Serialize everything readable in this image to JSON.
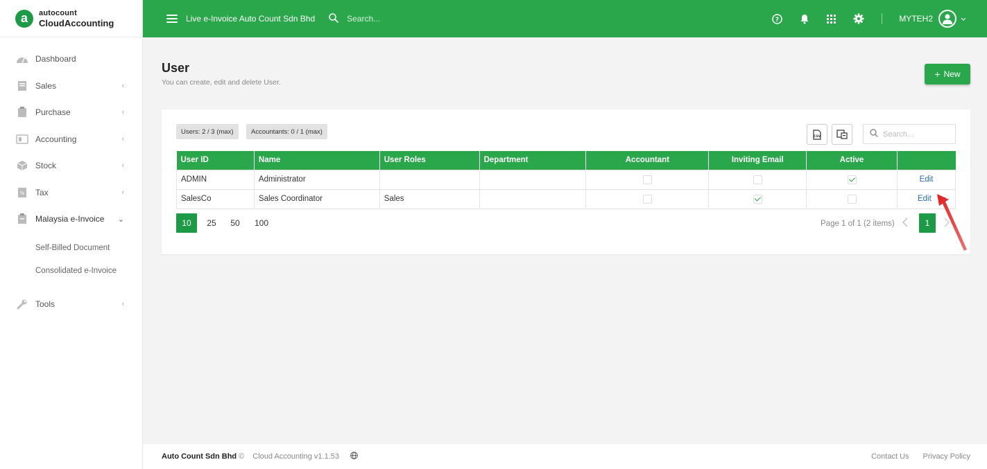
{
  "brand": {
    "top": "autocount",
    "bottom": "CloudAccounting",
    "mark": "a"
  },
  "sidebar": {
    "items": [
      {
        "label": "Dashboard",
        "icon": "dashboard-icon",
        "chevron": ""
      },
      {
        "label": "Sales",
        "icon": "sales-icon",
        "chevron": "‹"
      },
      {
        "label": "Purchase",
        "icon": "purchase-icon",
        "chevron": "‹"
      },
      {
        "label": "Accounting",
        "icon": "accounting-icon",
        "chevron": "‹"
      },
      {
        "label": "Stock",
        "icon": "stock-icon",
        "chevron": "‹"
      },
      {
        "label": "Tax",
        "icon": "tax-icon",
        "chevron": "‹"
      },
      {
        "label": "Malaysia e-Invoice",
        "icon": "einvoice-icon",
        "chevron": "⌄"
      }
    ],
    "subitems": [
      "Self-Billed Document",
      "Consolidated e-Invoice"
    ],
    "tools": {
      "label": "Tools",
      "icon": "wrench-icon",
      "chevron": "‹"
    }
  },
  "topbar": {
    "company": "Live e-Invoice Auto Count Sdn Bhd",
    "search_placeholder": "Search...",
    "username": "MYTEH2"
  },
  "page": {
    "title": "User",
    "subtitle": "You can create, edit and delete User.",
    "new_label": "New"
  },
  "badges": {
    "users": "Users: 2 / 3 (max)",
    "accountants": "Accountants: 0 / 1 (max)"
  },
  "card_search_placeholder": "Search...",
  "table": {
    "headers": [
      "User ID",
      "Name",
      "User Roles",
      "Department",
      "Accountant",
      "Inviting Email",
      "Active",
      ""
    ],
    "rows": [
      {
        "user_id": "ADMIN",
        "name": "Administrator",
        "roles": "",
        "department": "",
        "accountant": false,
        "inviting_email": false,
        "active": true,
        "action": "Edit"
      },
      {
        "user_id": "SalesCo",
        "name": "Sales Coordinator",
        "roles": "Sales",
        "department": "",
        "accountant": false,
        "inviting_email": true,
        "active": false,
        "action": "Edit"
      }
    ]
  },
  "pager": {
    "sizes": [
      "10",
      "25",
      "50",
      "100"
    ],
    "info": "Page 1 of 1 (2 items)",
    "current": "1"
  },
  "footer": {
    "company": "Auto Count Sdn Bhd",
    "copyright": "©",
    "version": "Cloud Accounting v1.1.53",
    "links": [
      "Contact Us",
      "Privacy Policy"
    ]
  },
  "colors": {
    "primary": "#29a74a",
    "primary_dark": "#1d9a46",
    "link": "#2b6cb0",
    "annotation_arrow": "#e02020"
  }
}
